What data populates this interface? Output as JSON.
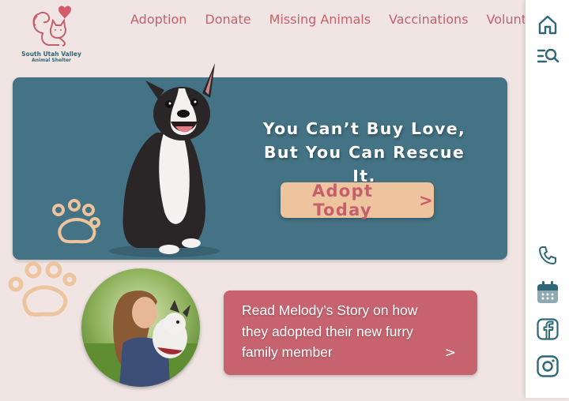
{
  "logo": {
    "name": "South Utah Valley",
    "subtitle": "Animal Shelter"
  },
  "nav": {
    "items": [
      "Adoption",
      "Donate",
      "Missing Animals",
      "Vaccinations",
      "Volunteer"
    ]
  },
  "sidebar": {
    "top_icons": [
      "home-icon",
      "search-list-icon"
    ],
    "bottom_icons": [
      "phone-icon",
      "calendar-icon",
      "facebook-icon",
      "instagram-icon"
    ]
  },
  "hero": {
    "headline_line1": "You Can’t Buy Love,",
    "headline_line2": "But You Can Rescue It.",
    "cta_label": "Adopt Today",
    "cta_arrow": ">"
  },
  "story": {
    "text": "Read Melody’s Story on how they adopted their new furry family member",
    "arrow": ">"
  },
  "colors": {
    "background": "#f0e5e3",
    "accent_pink": "#c65f6c",
    "hero_teal": "#447385",
    "button_peach": "#eec49f",
    "icon_teal": "#2f6777"
  }
}
